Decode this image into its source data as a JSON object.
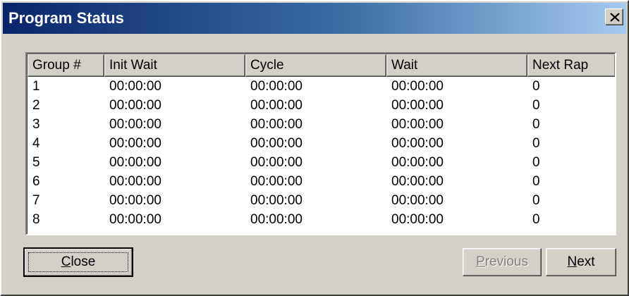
{
  "window": {
    "title": "Program Status",
    "colors": {
      "face": "#d4d0c8",
      "title_start": "#0a246a",
      "title_end": "#a6caf0"
    }
  },
  "table": {
    "columns": [
      "Group #",
      "Init Wait",
      "Cycle",
      "Wait",
      "Next Rap"
    ],
    "rows": [
      [
        "1",
        "00:00:00",
        "00:00:00",
        "00:00:00",
        "0"
      ],
      [
        "2",
        "00:00:00",
        "00:00:00",
        "00:00:00",
        "0"
      ],
      [
        "3",
        "00:00:00",
        "00:00:00",
        "00:00:00",
        "0"
      ],
      [
        "4",
        "00:00:00",
        "00:00:00",
        "00:00:00",
        "0"
      ],
      [
        "5",
        "00:00:00",
        "00:00:00",
        "00:00:00",
        "0"
      ],
      [
        "6",
        "00:00:00",
        "00:00:00",
        "00:00:00",
        "0"
      ],
      [
        "7",
        "00:00:00",
        "00:00:00",
        "00:00:00",
        "0"
      ],
      [
        "8",
        "00:00:00",
        "00:00:00",
        "00:00:00",
        "0"
      ]
    ]
  },
  "buttons": {
    "close": {
      "mnemonic": "C",
      "rest": "lose"
    },
    "previous": {
      "mnemonic": "P",
      "rest": "revious",
      "enabled": false
    },
    "next": {
      "mnemonic": "N",
      "rest": "ext"
    }
  },
  "icons": {
    "title_close": "close-icon"
  }
}
